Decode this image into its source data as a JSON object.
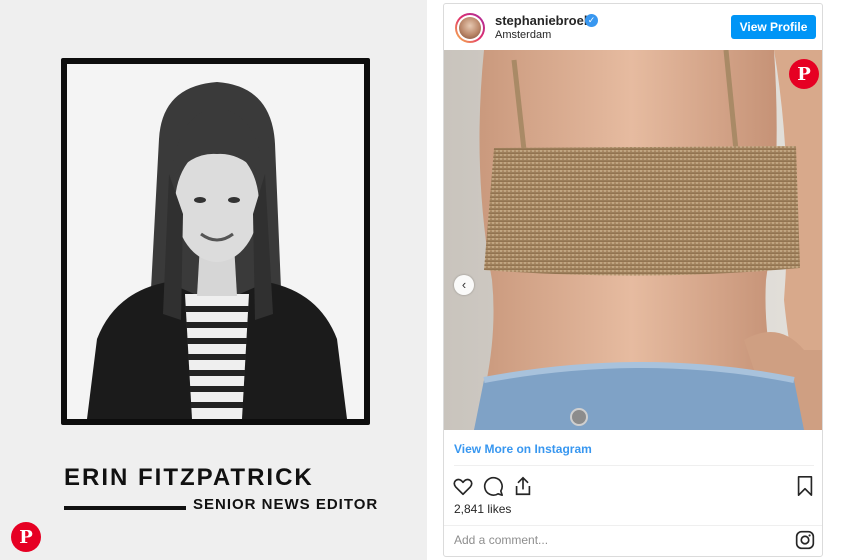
{
  "author_card": {
    "name": "ERIN FITZPATRICK",
    "title": "SENIOR NEWS EDITOR",
    "photo_icon": "author-portrait",
    "pin_icon": "pinterest-icon",
    "pin_glyph": "P"
  },
  "instagram": {
    "username": "stephaniebroek",
    "verified_glyph": "✓",
    "location": "Amsterdam",
    "view_profile_label": "View Profile",
    "view_more_label": "View More on Instagram",
    "likes": "2,841 likes",
    "comment_placeholder": "Add a comment...",
    "prev_arrow_glyph": "‹",
    "pin_glyph": "P",
    "actions": [
      "heart-icon",
      "comment-icon",
      "share-icon",
      "bookmark-icon"
    ]
  },
  "colors": {
    "pinterest_red": "#e60023",
    "instagram_blue": "#0095f6",
    "link_blue": "#3897f0",
    "card_background": "#efefef"
  }
}
